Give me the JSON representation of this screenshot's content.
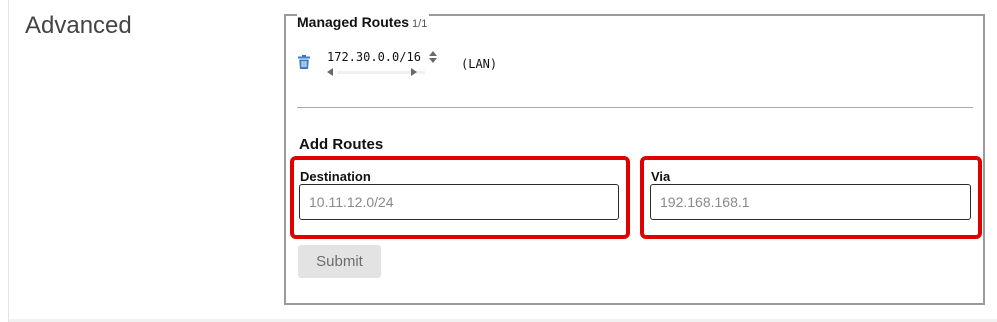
{
  "section": {
    "title": "Advanced"
  },
  "managed_routes": {
    "title": "Managed Routes",
    "count": "1/1",
    "routes": [
      {
        "network": "172.30.0.0/16",
        "interface": "(LAN)"
      }
    ],
    "icons": {
      "delete": "trash-icon",
      "spinner": "spin-updown-icon",
      "scroll_left": "arrow-left-icon",
      "scroll_right": "arrow-right-icon"
    }
  },
  "add_routes": {
    "title": "Add Routes",
    "destination": {
      "label": "Destination",
      "value": "",
      "placeholder": "10.11.12.0/24"
    },
    "via": {
      "label": "Via",
      "value": "",
      "placeholder": "192.168.168.1"
    },
    "submit_label": "Submit"
  },
  "colors": {
    "highlight": "#e00000",
    "trash_icon": "#3a7cc7",
    "submit_bg": "#e3e3e3",
    "submit_text": "#6d6d6d"
  }
}
